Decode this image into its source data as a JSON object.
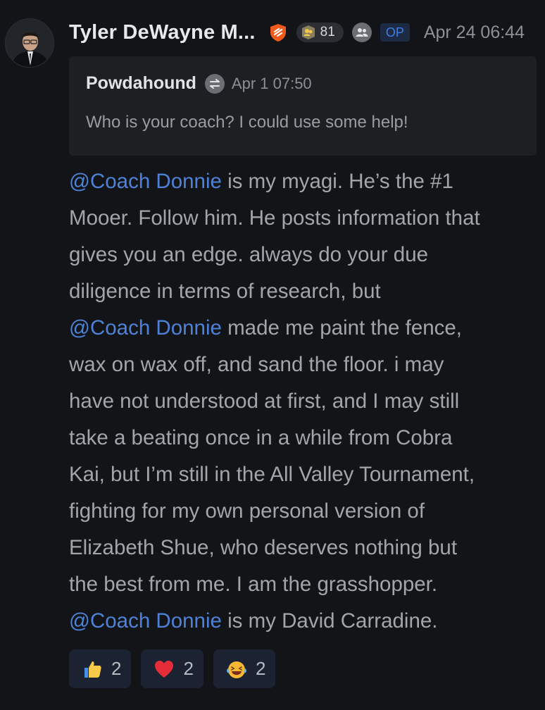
{
  "post": {
    "author": "Tyler DeWayne M...",
    "level": "81",
    "op_label": "OP",
    "timestamp": "Apr 24 06:44"
  },
  "quote": {
    "author": "Powdahound",
    "timestamp": "Apr 1 07:50",
    "text": "Who is your coach? I could use some help!"
  },
  "body_lines": [
    [
      {
        "t": "@Coach Donnie",
        "m": true
      },
      {
        "t": " is my myagi. He’s the #1"
      }
    ],
    [
      {
        "t": "Mooer. Follow him. He posts information that"
      }
    ],
    [
      {
        "t": "gives you an edge. always do your due"
      }
    ],
    [
      {
        "t": "diligence in terms of research, but"
      }
    ],
    [
      {
        "t": "@Coach Donnie",
        "m": true
      },
      {
        "t": " made me paint the fence,"
      }
    ],
    [
      {
        "t": "wax on wax off, and sand the floor. i may"
      }
    ],
    [
      {
        "t": "have not understood at first, and I may still"
      }
    ],
    [
      {
        "t": "take a beating once in a while from Cobra"
      }
    ],
    [
      {
        "t": "Kai, but I’m still in the All Valley Tournament,"
      }
    ],
    [
      {
        "t": "fighting for my own personal version of"
      }
    ],
    [
      {
        "t": "Elizabeth Shue, who deserves nothing but"
      }
    ],
    [
      {
        "t": "the best from me. I am the grasshopper."
      }
    ],
    [
      {
        "t": "@Coach Donnie",
        "m": true
      },
      {
        "t": " is my David Carradine."
      }
    ]
  ],
  "reactions": [
    {
      "icon": "thumbs-up-icon",
      "count": "2"
    },
    {
      "icon": "heart-icon",
      "count": "2"
    },
    {
      "icon": "laughing-tears-icon",
      "count": "2"
    }
  ],
  "colors": {
    "background": "#131417",
    "mention": "#4e82d9",
    "op_badge": "#3f7fe6",
    "shield": "#f05a1a"
  }
}
